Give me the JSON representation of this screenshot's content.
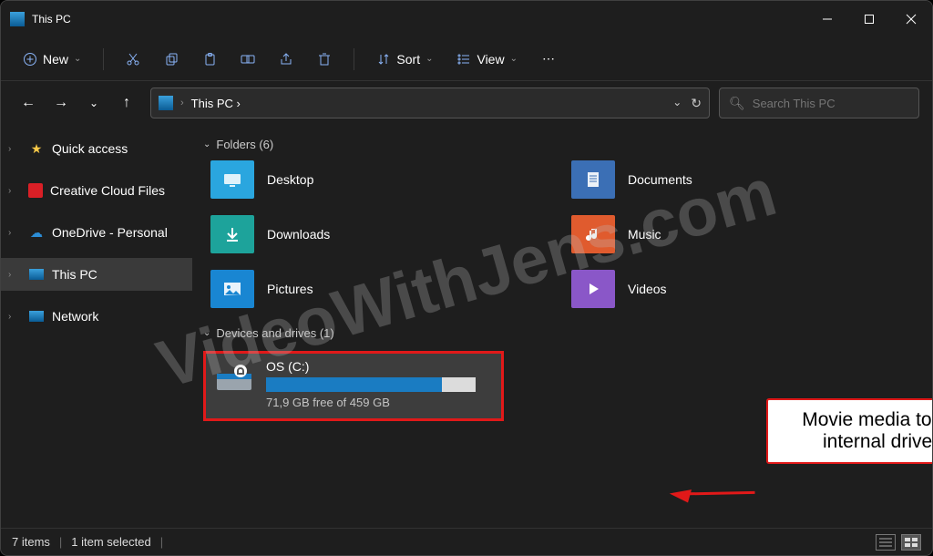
{
  "window": {
    "title": "This PC"
  },
  "toolbar": {
    "new_label": "New",
    "sort_label": "Sort",
    "view_label": "View"
  },
  "breadcrumb": {
    "path": "This PC  ›"
  },
  "search": {
    "placeholder": "Search This PC"
  },
  "sidebar": {
    "items": [
      {
        "label": "Quick access",
        "selected": false,
        "icon": "star"
      },
      {
        "label": "Creative Cloud Files",
        "selected": false,
        "icon": "cc"
      },
      {
        "label": "OneDrive - Personal",
        "selected": false,
        "icon": "cloud"
      },
      {
        "label": "This PC",
        "selected": true,
        "icon": "pc"
      },
      {
        "label": "Network",
        "selected": false,
        "icon": "network"
      }
    ]
  },
  "sections": {
    "folders_header": "Folders (6)",
    "drives_header": "Devices and drives (1)"
  },
  "folders": [
    {
      "name": "Desktop",
      "color": "#2aa6df"
    },
    {
      "name": "Documents",
      "color": "#3b6fb5"
    },
    {
      "name": "Downloads",
      "color": "#1da39b"
    },
    {
      "name": "Music",
      "color": "#e05b2e"
    },
    {
      "name": "Pictures",
      "color": "#1986d2"
    },
    {
      "name": "Videos",
      "color": "#8a57c8"
    }
  ],
  "drive": {
    "name": "OS (C:)",
    "free_text": "71,9 GB free of 459 GB",
    "used_pct": 84
  },
  "status": {
    "items": "7 items",
    "selected": "1 item selected"
  },
  "callout": {
    "text": "Movie media to an internal drive."
  },
  "watermark": "VideoWithJens.com"
}
